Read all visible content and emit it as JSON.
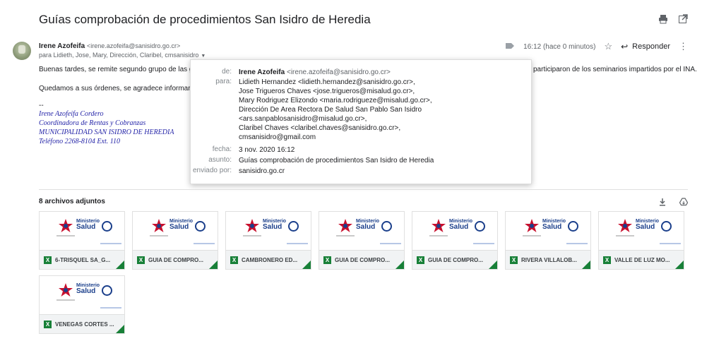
{
  "email": {
    "subject": "Guías comprobación de procedimientos San Isidro de Heredia",
    "sender_name": "Irene Azofeifa",
    "sender_email": "<irene.azofeifa@sanisidro.go.cr>",
    "recipients_summary": "para Lidieth, Jose, Mary, Dirección, Claribel, cmsanisidro",
    "time": "16:12 (hace 0 minutos)",
    "reply_label": "Responder",
    "body_line1": "Buenas tardes, se remite segundo grupo de las guías d",
    "body_line1_end": "participaron de los seminarios  impartidos por el INA.",
    "body_line2": "Quedamos a sus órdenes, se agradece informar cual e",
    "sig_dash": "--",
    "signature": [
      "Irene Azofeifa Cordero",
      "Coordinadora de Rentas y Cobranzas",
      "MUNICIPALIDAD SAN ISIDRO DE HEREDIA",
      "Teléfono 2268-8104  Ext. 110"
    ]
  },
  "popup": {
    "de_label": "de:",
    "de_name": "Irene Azofeifa",
    "de_email": "<irene.azofeifa@sanisidro.go.cr>",
    "para_label": "para:",
    "para_lines": [
      "Lidieth Hernandez <lidieth.hernandez@sanisidro.go.cr>,",
      "Jose Trigueros Chaves <jose.trigueros@misalud.go.cr>,",
      "Mary Rodriguez Elizondo <maria.rodrigueze@misalud.go.cr>,",
      "Dirección De Area Rectora De Salud San Pablo San Isidro",
      "<ars.sanpablosanisidro@misalud.go.cr>,",
      "Claribel Chaves <claribel.chaves@sanisidro.go.cr>,",
      "cmsanisidro@gmail.com"
    ],
    "fecha_label": "fecha:",
    "fecha": "3 nov. 2020 16:12",
    "asunto_label": "asunto:",
    "asunto": "Guías comprobación de procedimientos San Isidro de Heredia",
    "enviado_label": "enviado por:",
    "enviado": "sanisidro.go.cr"
  },
  "attachments": {
    "title": "8 archivos adjuntos",
    "files": [
      "6-TRISQUEL SA_G...",
      "GUIA DE COMPRO...",
      "CAMBRONERO ED...",
      "GUIA DE COMPRO...",
      "GUIA DE COMPRO...",
      "RIVERA VILLALOB...",
      "VALLE DE LUZ MO...",
      "VENEGAS CORTES ..."
    ],
    "thumb_logo_line1": "Ministerio",
    "thumb_logo_line2": "Salud",
    "file_icon_letter": "X"
  },
  "icons": [
    "print-icon",
    "open-new-window-icon",
    "label-icon",
    "star-icon",
    "reply-icon",
    "more-icon",
    "download-icon",
    "drive-icon"
  ],
  "colors": {
    "signature": "#2525a8",
    "excel": "#188038",
    "brand_blue": "#1b3f8b"
  }
}
